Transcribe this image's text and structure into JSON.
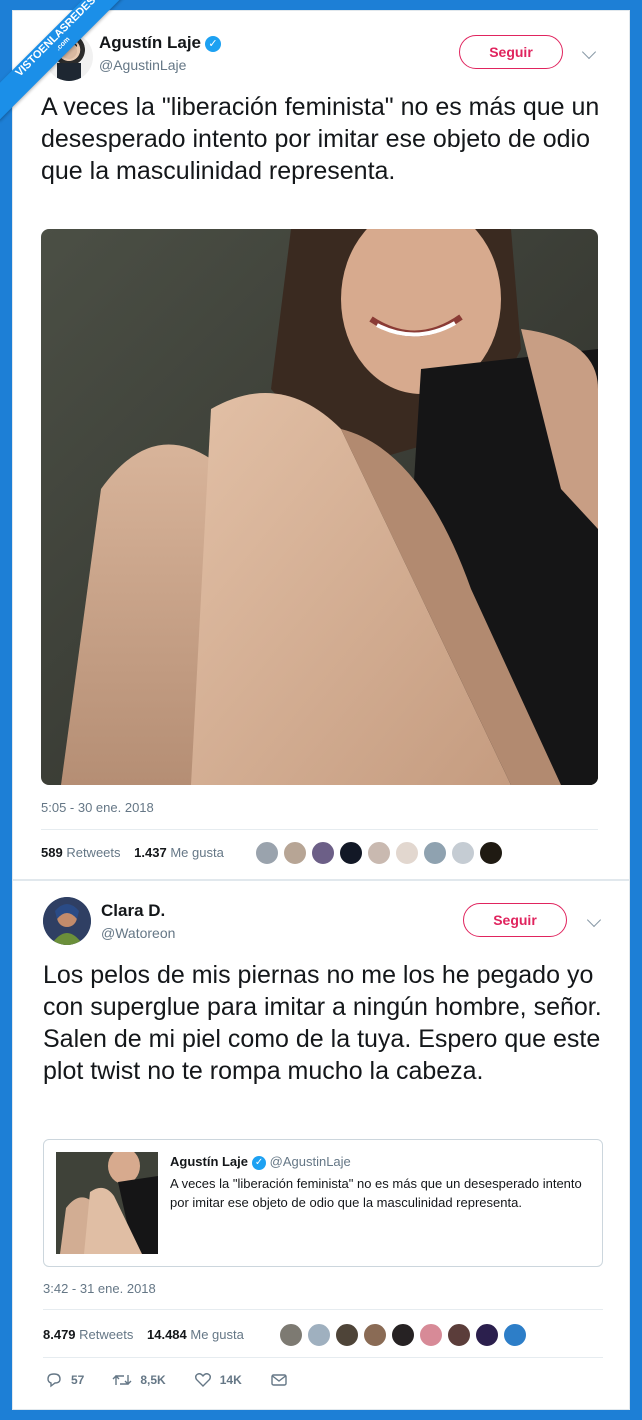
{
  "watermark": {
    "line1": "VISTOENLASREDES",
    "line2": ".com"
  },
  "tweet1": {
    "author_name": "Agustín Laje",
    "author_handle": "@AgustinLaje",
    "follow_label": "Seguir",
    "text": "A veces la \"liberación feminista\" no es más que un desesperado intento por imitar ese objeto de odio que la masculinidad representa.",
    "timestamp": "5:05 - 30 ene. 2018",
    "retweets_count": "589",
    "retweets_label": "Retweets",
    "likes_count": "1.437",
    "likes_label": "Me gusta"
  },
  "tweet2": {
    "author_name": "Clara D.",
    "author_handle": "@Watoreon",
    "follow_label": "Seguir",
    "text": "Los pelos de mis piernas no me los he pegado yo con superglue para imitar a ningún hombre, señor. Salen de mi piel como de la tuya. Espero que este plot twist no te rompa mucho la cabeza.",
    "quote": {
      "author_name": "Agustín Laje",
      "author_handle": "@AgustinLaje",
      "text": "A veces la \"liberación feminista\" no es más que un desesperado intento por imitar ese objeto de odio que la masculinidad representa."
    },
    "timestamp": "3:42 - 31 ene. 2018",
    "retweets_count": "8.479",
    "retweets_label": "Retweets",
    "likes_count": "14.484",
    "likes_label": "Me gusta",
    "actions": {
      "replies": "57",
      "retweets": "8,5K",
      "likes": "14K"
    }
  },
  "icons": {
    "verified": "verified-badge-icon",
    "reply": "reply-icon",
    "retweet": "retweet-icon",
    "like": "heart-icon",
    "dm": "envelope-icon",
    "more": "chevron-down-icon"
  },
  "colors": {
    "background": "#1d7fd6",
    "follow_accent": "#e0245e",
    "verified": "#1da1f2",
    "secondary_text": "#657786"
  }
}
